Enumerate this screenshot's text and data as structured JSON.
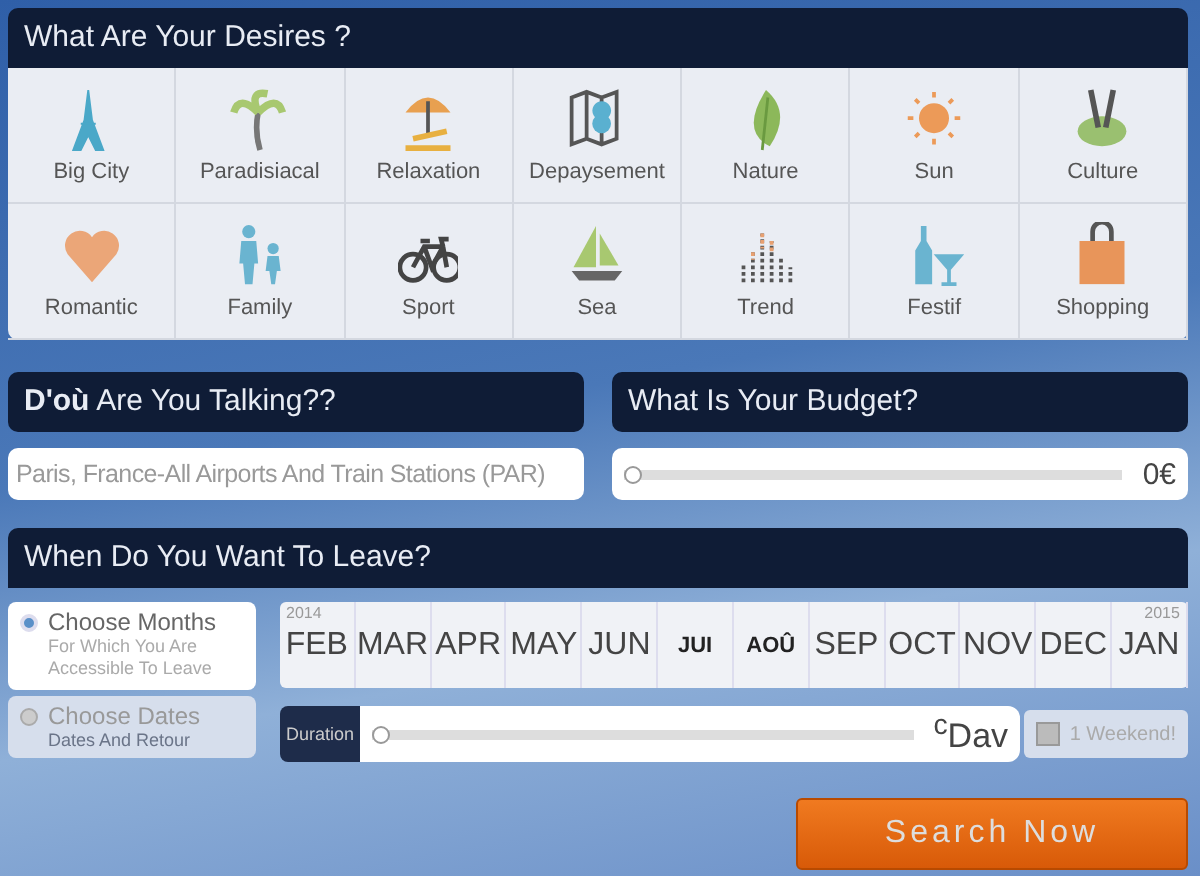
{
  "desires": {
    "title": "What Are Your Desires ?",
    "items": [
      {
        "label": "Big City"
      },
      {
        "label": "Paradisiacal"
      },
      {
        "label": "Relaxation"
      },
      {
        "label": "Depaysement"
      },
      {
        "label": "Nature"
      },
      {
        "label": "Sun"
      },
      {
        "label": "Culture"
      },
      {
        "label": "Romantic"
      },
      {
        "label": "Family"
      },
      {
        "label": "Sport"
      },
      {
        "label": "Sea"
      },
      {
        "label": "Trend"
      },
      {
        "label": "Festif"
      },
      {
        "label": "Shopping"
      }
    ]
  },
  "origin": {
    "title": "**D'où** Are You Talking??",
    "placeholder": "Paris, France-All Airports And Train Stations (PAR)"
  },
  "budget": {
    "title": "What Is Your Budget?",
    "level": 0,
    "reading": "0€"
  },
  "when": {
    "title": "When Do You Want To Leave?",
    "options": [
      {
        "label": "Choose Months",
        "hint": "For Which You Are Accessible To Leave",
        "selected": true
      },
      {
        "label": "Choose Dates",
        "hint": "Dates And Retour",
        "selected": false
      }
    ],
    "months": [
      {
        "label": "FEB",
        "kind": "full",
        "year": "2014"
      },
      {
        "label": "MAR",
        "kind": "full"
      },
      {
        "label": "APR",
        "kind": "full"
      },
      {
        "label": "MAY",
        "kind": "full"
      },
      {
        "label": "JUN",
        "kind": "full"
      },
      {
        "label": "JUI",
        "kind": "short"
      },
      {
        "label": "AOÛ",
        "kind": "short"
      },
      {
        "label": "SEP",
        "kind": "full"
      },
      {
        "label": "OCT",
        "kind": "full"
      },
      {
        "label": "NOV",
        "kind": "full"
      },
      {
        "label": "DEC",
        "kind": "full"
      },
      {
        "label": "JAN",
        "kind": "full",
        "year": "2015"
      }
    ],
    "duration": {
      "label": "Duration",
      "level": 0,
      "reading": "$^{c}$Dav"
    },
    "weekend": {
      "label": "1 Weekend!",
      "checked": false
    }
  },
  "search_button": "Search Now"
}
